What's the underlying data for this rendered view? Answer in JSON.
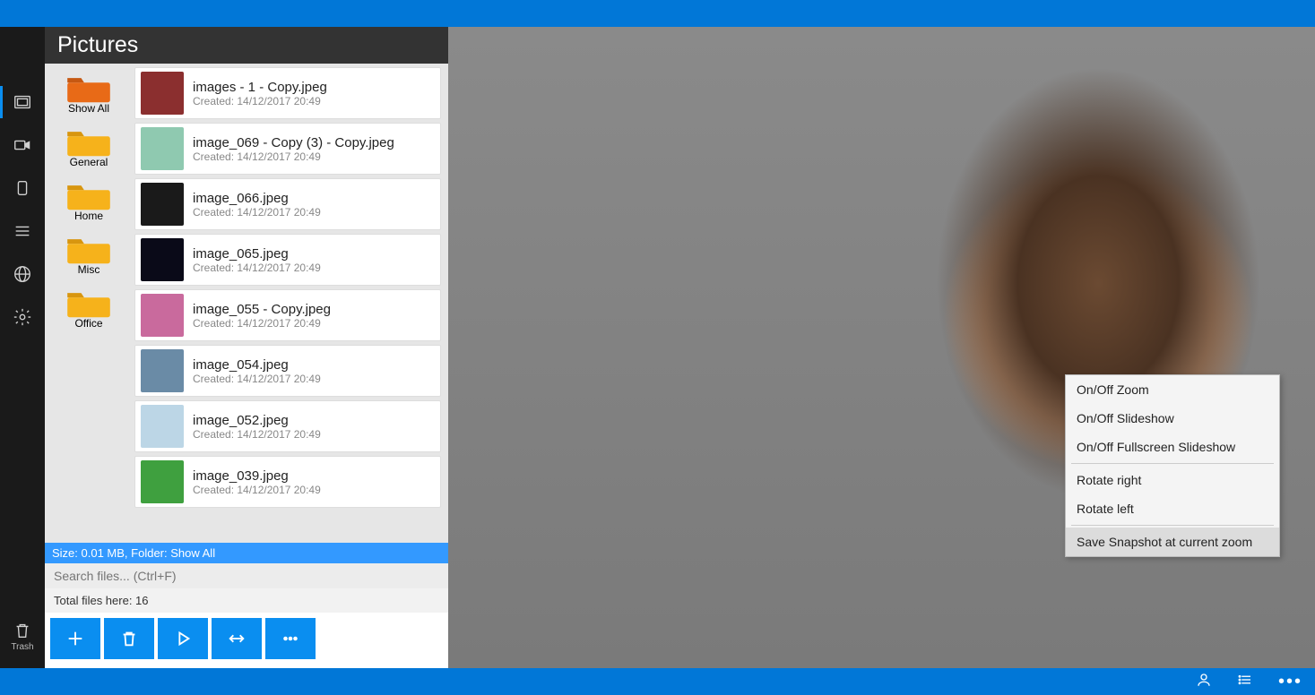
{
  "title": "Pictures",
  "rail": {
    "trash_label": "Trash"
  },
  "folders": [
    {
      "label": "Show All",
      "kind": "showall"
    },
    {
      "label": "General",
      "kind": "reg"
    },
    {
      "label": "Home",
      "kind": "reg"
    },
    {
      "label": "Misc",
      "kind": "reg"
    },
    {
      "label": "Office",
      "kind": "reg"
    }
  ],
  "files": [
    {
      "name": "images - 1 - Copy.jpeg",
      "meta": "Created: 14/12/2017 20:49",
      "thumb": "#8b2f2f"
    },
    {
      "name": "image_069 - Copy (3) - Copy.jpeg",
      "meta": "Created: 14/12/2017 20:49",
      "thumb": "#8fc9b0"
    },
    {
      "name": "image_066.jpeg",
      "meta": "Created: 14/12/2017 20:49",
      "thumb": "#1a1a1a"
    },
    {
      "name": "image_065.jpeg",
      "meta": "Created: 14/12/2017 20:49",
      "thumb": "#0a0a18"
    },
    {
      "name": "image_055 - Copy.jpeg",
      "meta": "Created: 14/12/2017 20:49",
      "thumb": "#c96a9d"
    },
    {
      "name": "image_054.jpeg",
      "meta": "Created: 14/12/2017 20:49",
      "thumb": "#6a8ba6"
    },
    {
      "name": "image_052.jpeg",
      "meta": "Created: 14/12/2017 20:49",
      "thumb": "#bcd6e6"
    },
    {
      "name": "image_039.jpeg",
      "meta": "Created: 14/12/2017 20:49",
      "thumb": "#3fa03f"
    }
  ],
  "status": "Size: 0.01 MB, Folder: Show All",
  "search_placeholder": "Search files... (Ctrl+F)",
  "total_line": "Total files here: 16",
  "context_menu": {
    "items": [
      "On/Off Zoom",
      "On/Off  Slideshow",
      "On/Off  Fullscreen Slideshow"
    ],
    "rotate": [
      "Rotate right",
      "Rotate left"
    ],
    "snapshot": "Save Snapshot at current zoom"
  }
}
